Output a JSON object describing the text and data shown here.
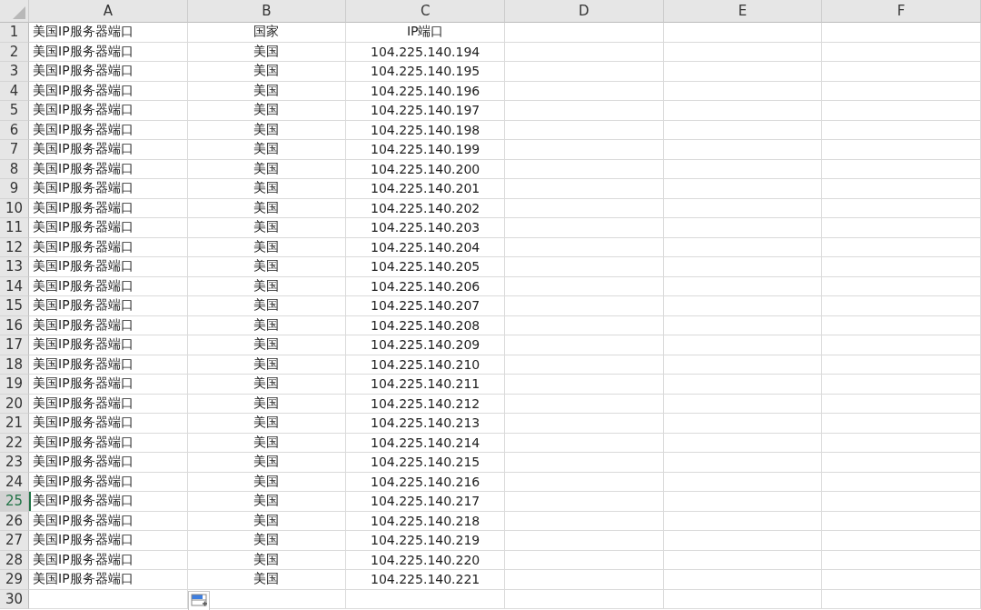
{
  "columns": [
    "A",
    "B",
    "C",
    "D",
    "E",
    "F"
  ],
  "rows": [
    {
      "number": "1",
      "cells": [
        "美国IP服务器端口",
        "国家",
        "IP端口"
      ],
      "selected": false
    },
    {
      "number": "2",
      "cells": [
        "美国IP服务器端口",
        "美国",
        "104.225.140.194"
      ],
      "selected": false
    },
    {
      "number": "3",
      "cells": [
        "美国IP服务器端口",
        "美国",
        "104.225.140.195"
      ],
      "selected": false
    },
    {
      "number": "4",
      "cells": [
        "美国IP服务器端口",
        "美国",
        "104.225.140.196"
      ],
      "selected": false
    },
    {
      "number": "5",
      "cells": [
        "美国IP服务器端口",
        "美国",
        "104.225.140.197"
      ],
      "selected": false
    },
    {
      "number": "6",
      "cells": [
        "美国IP服务器端口",
        "美国",
        "104.225.140.198"
      ],
      "selected": false
    },
    {
      "number": "7",
      "cells": [
        "美国IP服务器端口",
        "美国",
        "104.225.140.199"
      ],
      "selected": false
    },
    {
      "number": "8",
      "cells": [
        "美国IP服务器端口",
        "美国",
        "104.225.140.200"
      ],
      "selected": false
    },
    {
      "number": "9",
      "cells": [
        "美国IP服务器端口",
        "美国",
        "104.225.140.201"
      ],
      "selected": false
    },
    {
      "number": "10",
      "cells": [
        "美国IP服务器端口",
        "美国",
        "104.225.140.202"
      ],
      "selected": false
    },
    {
      "number": "11",
      "cells": [
        "美国IP服务器端口",
        "美国",
        "104.225.140.203"
      ],
      "selected": false
    },
    {
      "number": "12",
      "cells": [
        "美国IP服务器端口",
        "美国",
        "104.225.140.204"
      ],
      "selected": false
    },
    {
      "number": "13",
      "cells": [
        "美国IP服务器端口",
        "美国",
        "104.225.140.205"
      ],
      "selected": false
    },
    {
      "number": "14",
      "cells": [
        "美国IP服务器端口",
        "美国",
        "104.225.140.206"
      ],
      "selected": false
    },
    {
      "number": "15",
      "cells": [
        "美国IP服务器端口",
        "美国",
        "104.225.140.207"
      ],
      "selected": false
    },
    {
      "number": "16",
      "cells": [
        "美国IP服务器端口",
        "美国",
        "104.225.140.208"
      ],
      "selected": false
    },
    {
      "number": "17",
      "cells": [
        "美国IP服务器端口",
        "美国",
        "104.225.140.209"
      ],
      "selected": false
    },
    {
      "number": "18",
      "cells": [
        "美国IP服务器端口",
        "美国",
        "104.225.140.210"
      ],
      "selected": false
    },
    {
      "number": "19",
      "cells": [
        "美国IP服务器端口",
        "美国",
        "104.225.140.211"
      ],
      "selected": false
    },
    {
      "number": "20",
      "cells": [
        "美国IP服务器端口",
        "美国",
        "104.225.140.212"
      ],
      "selected": false
    },
    {
      "number": "21",
      "cells": [
        "美国IP服务器端口",
        "美国",
        "104.225.140.213"
      ],
      "selected": false
    },
    {
      "number": "22",
      "cells": [
        "美国IP服务器端口",
        "美国",
        "104.225.140.214"
      ],
      "selected": false
    },
    {
      "number": "23",
      "cells": [
        "美国IP服务器端口",
        "美国",
        "104.225.140.215"
      ],
      "selected": false
    },
    {
      "number": "24",
      "cells": [
        "美国IP服务器端口",
        "美国",
        "104.225.140.216"
      ],
      "selected": false
    },
    {
      "number": "25",
      "cells": [
        "美国IP服务器端口",
        "美国",
        "104.225.140.217"
      ],
      "selected": true
    },
    {
      "number": "26",
      "cells": [
        "美国IP服务器端口",
        "美国",
        "104.225.140.218"
      ],
      "selected": false
    },
    {
      "number": "27",
      "cells": [
        "美国IP服务器端口",
        "美国",
        "104.225.140.219"
      ],
      "selected": false
    },
    {
      "number": "28",
      "cells": [
        "美国IP服务器端口",
        "美国",
        "104.225.140.220"
      ],
      "selected": false
    },
    {
      "number": "29",
      "cells": [
        "美国IP服务器端口",
        "美国",
        "104.225.140.221"
      ],
      "selected": false
    },
    {
      "number": "30",
      "cells": [],
      "selected": false
    }
  ]
}
